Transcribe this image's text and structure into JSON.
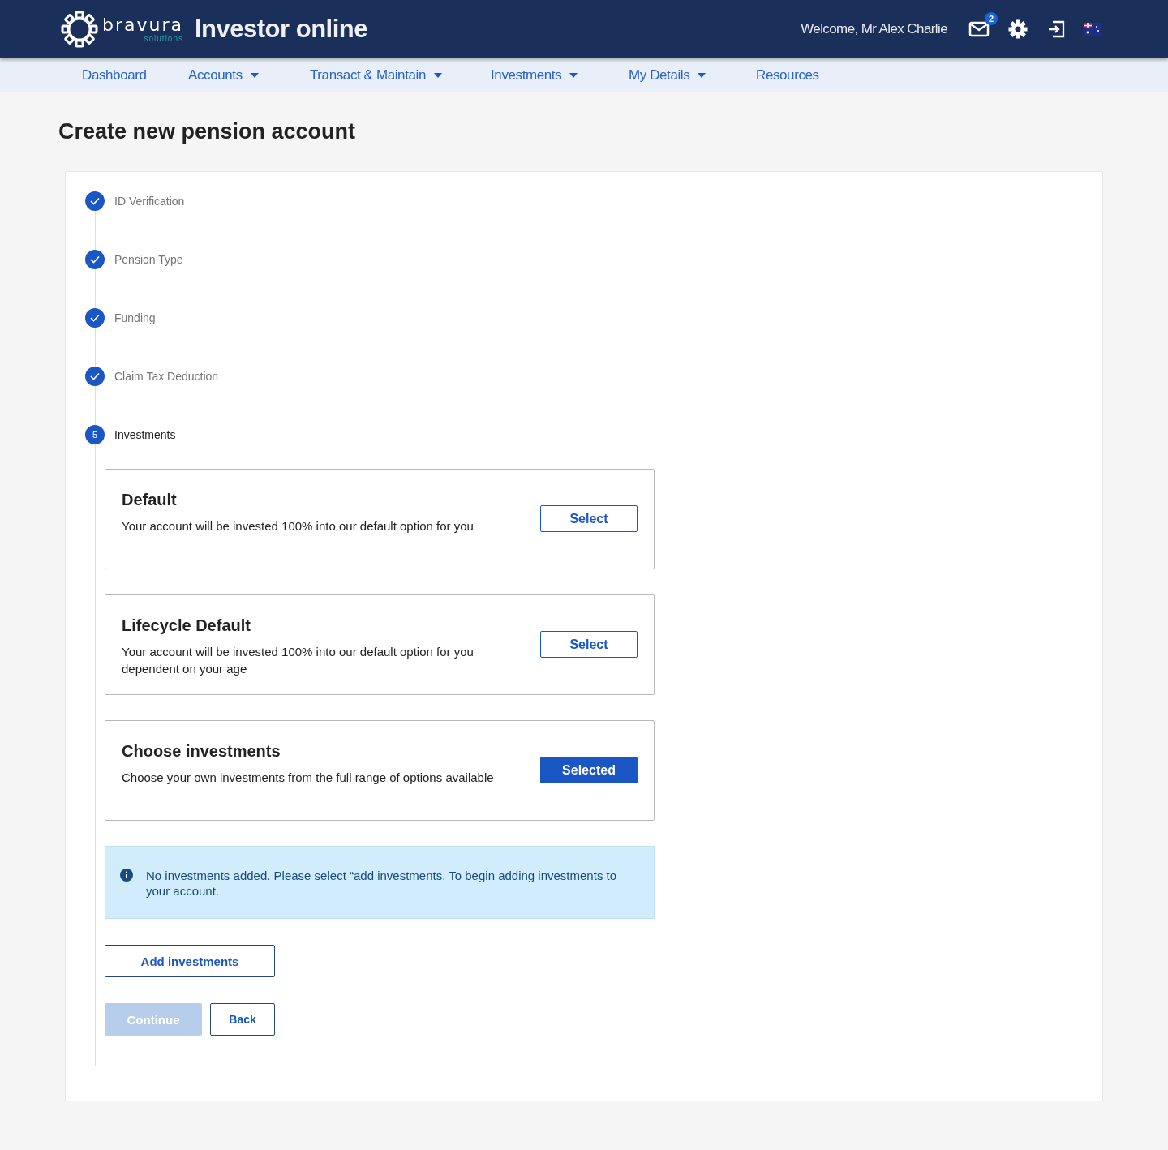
{
  "header": {
    "brand": "bravura",
    "brand_sub": "solutions",
    "app_title": "Investor online",
    "welcome": "Welcome, Mr Alex Charlie",
    "mail_badge": "2"
  },
  "nav": [
    {
      "label": "Dashboard",
      "dropdown": false
    },
    {
      "label": "Accounts",
      "dropdown": true
    },
    {
      "label": "Transact & Maintain",
      "dropdown": true
    },
    {
      "label": "Investments",
      "dropdown": true
    },
    {
      "label": "My Details",
      "dropdown": true
    },
    {
      "label": "Resources",
      "dropdown": false
    }
  ],
  "page_title": "Create new pension account",
  "steps": [
    {
      "label": "ID Verification",
      "completed": true
    },
    {
      "label": "Pension Type",
      "completed": true
    },
    {
      "label": "Funding",
      "completed": true
    },
    {
      "label": "Claim Tax Deduction",
      "completed": true
    },
    {
      "label": "Investments",
      "completed": false,
      "number": "5"
    }
  ],
  "options": [
    {
      "title": "Default",
      "description": "Your account will be invested 100% into our default option for you",
      "button": "Select",
      "selected": false
    },
    {
      "title": "Lifecycle Default",
      "description": "Your account will be invested 100% into our default option for you dependent on your age",
      "button": "Select",
      "selected": false
    },
    {
      "title": "Choose investments",
      "description": "Choose your own investments from the full range of options available",
      "button": "Selected",
      "selected": true
    }
  ],
  "info": "No investments added. Please select “add investments. To begin adding investments to your account.",
  "add_button": "Add investments",
  "continue": {
    "label": "Continue",
    "disabled": true
  },
  "back": "Back"
}
